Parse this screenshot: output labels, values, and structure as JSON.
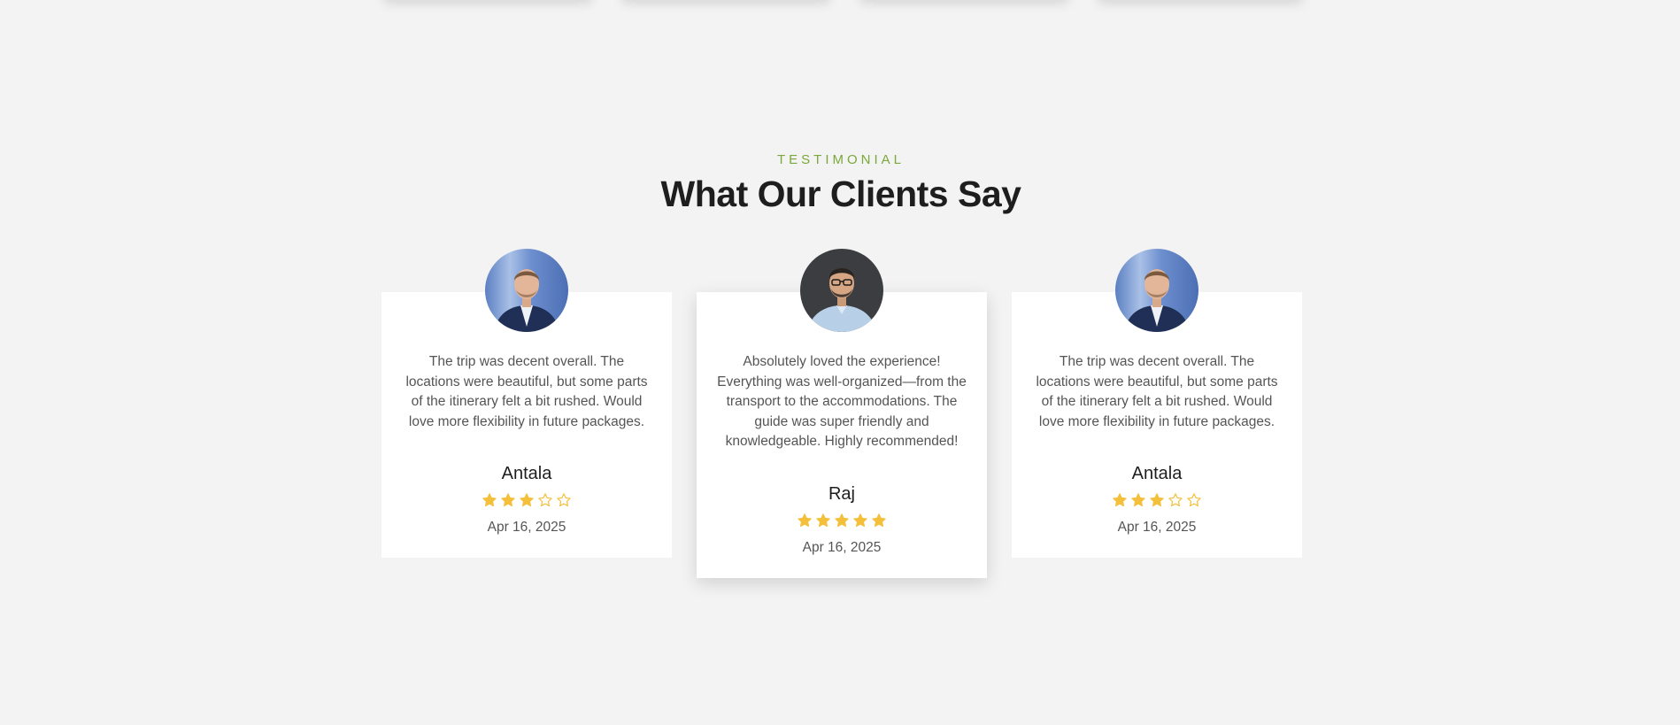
{
  "section": {
    "eyebrow": "TESTIMONIAL",
    "title": "What Our Clients Say"
  },
  "colors": {
    "accent": "#7aa83a",
    "star": "#f4bf3a",
    "background": "#f3f3f3"
  },
  "testimonials": [
    {
      "review": "The trip was decent overall. The locations were beautiful, but some parts of the itinerary felt a bit rushed. Would love more flexibility in future packages.",
      "name": "Antala",
      "rating": 3,
      "max_rating": 5,
      "date": "Apr 16, 2025",
      "avatar_icon": "man-in-navy-suit-avatar"
    },
    {
      "review": "Absolutely loved the experience! Everything was well-organized—from the transport to the accommodations. The guide was super friendly and knowledgeable. Highly recommended!",
      "name": "Raj",
      "rating": 5,
      "max_rating": 5,
      "date": "Apr 16, 2025",
      "avatar_icon": "man-with-glasses-avatar"
    },
    {
      "review": "The trip was decent overall. The locations were beautiful, but some parts of the itinerary felt a bit rushed. Would love more flexibility in future packages.",
      "name": "Antala",
      "rating": 3,
      "max_rating": 5,
      "date": "Apr 16, 2025",
      "avatar_icon": "man-in-navy-suit-avatar"
    }
  ]
}
